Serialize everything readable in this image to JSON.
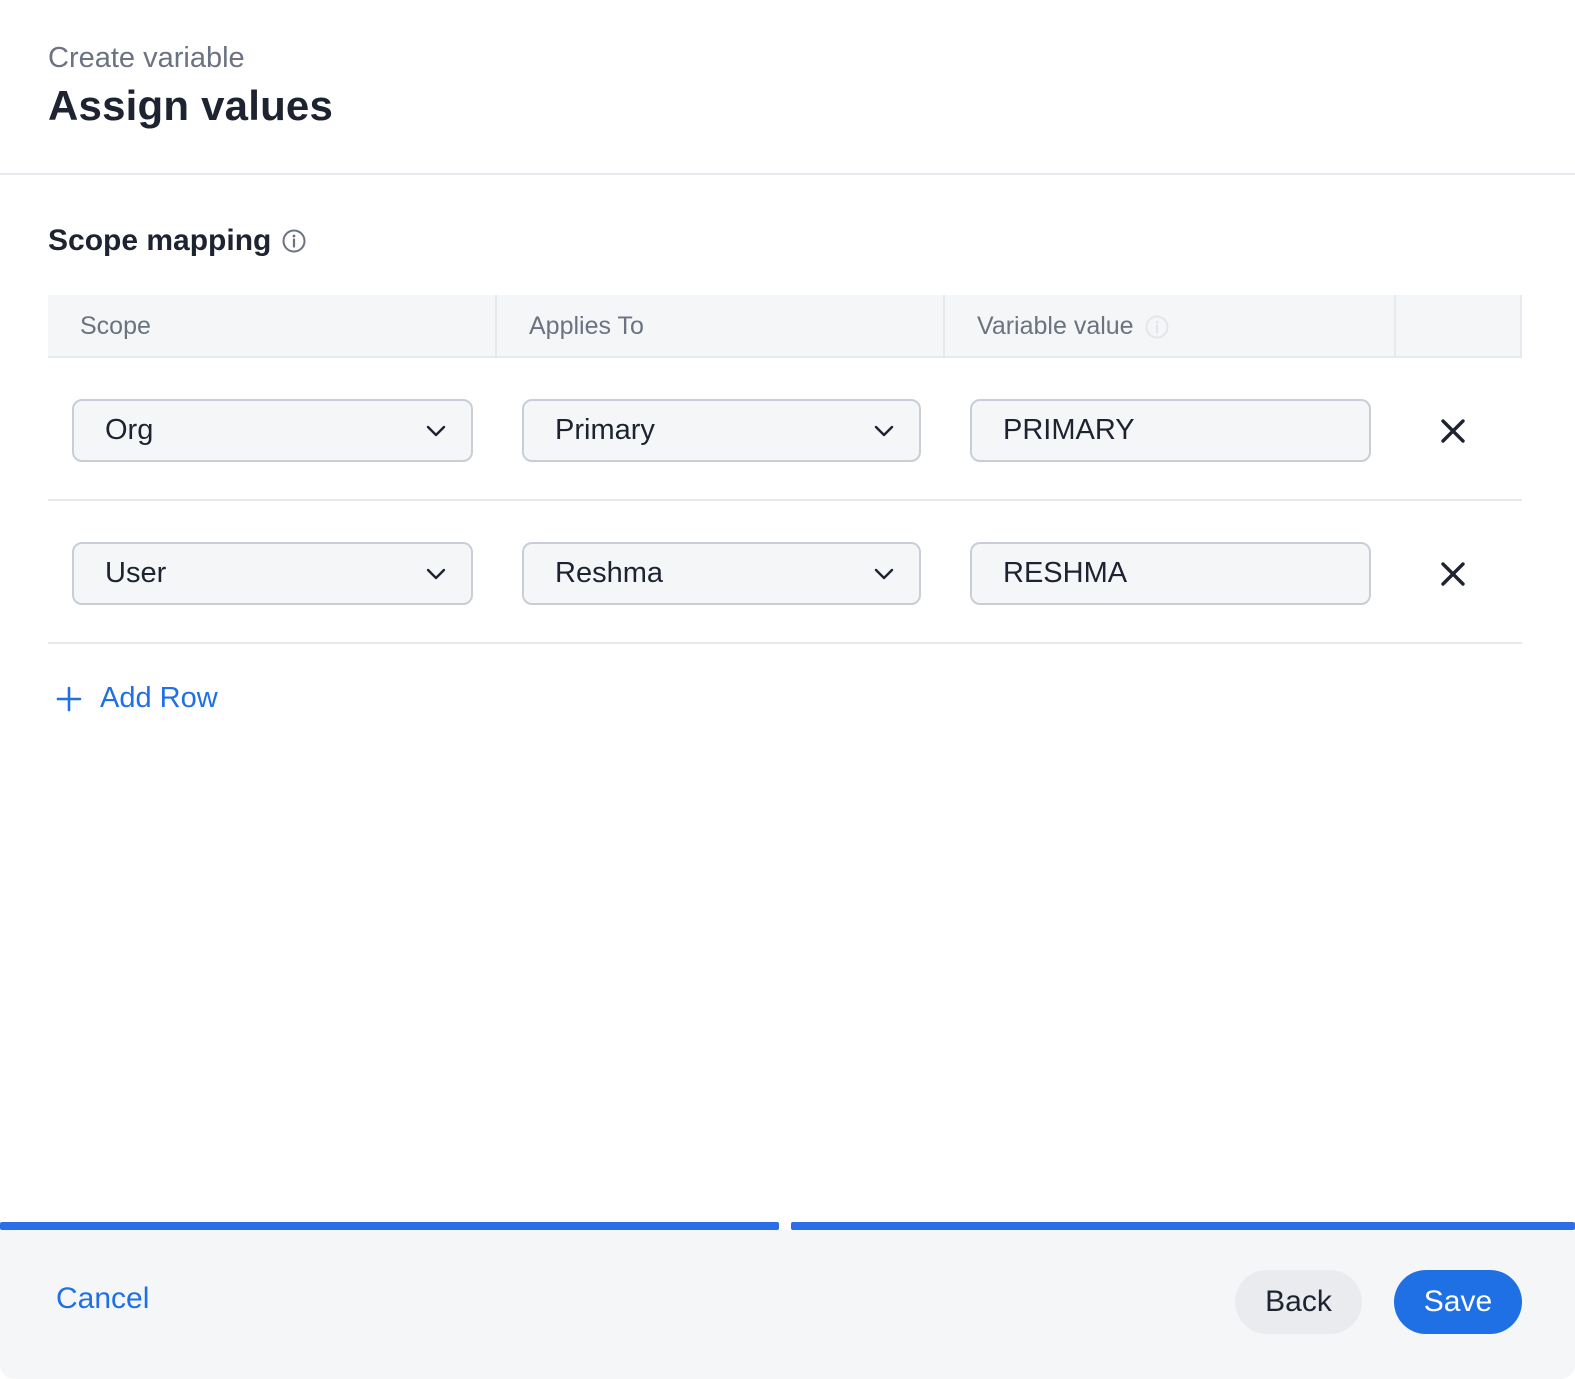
{
  "header": {
    "subtitle": "Create variable",
    "title": "Assign values"
  },
  "section": {
    "title": "Scope mapping",
    "info_icon": "info-icon"
  },
  "table": {
    "columns": [
      {
        "label": "Scope"
      },
      {
        "label": "Applies To"
      },
      {
        "label": "Variable value",
        "icon": "info-icon"
      },
      {
        "label": ""
      }
    ],
    "rows": [
      {
        "scope": "Org",
        "applies_to": "Primary",
        "value": "PRIMARY",
        "remove_icon": "close-icon"
      },
      {
        "scope": "User",
        "applies_to": "Reshma",
        "value": "RESHMA",
        "remove_icon": "close-icon"
      }
    ]
  },
  "add_row": {
    "label": "Add Row",
    "icon": "plus-icon"
  },
  "progress": {
    "steps": 2,
    "completed": 2,
    "color": "#2b6ee8"
  },
  "footer": {
    "cancel_label": "Cancel",
    "back_label": "Back",
    "save_label": "Save"
  },
  "colors": {
    "accent": "#1f6fe5",
    "text": "#1d2330",
    "muted": "#6b7280",
    "border": "#c9ced6",
    "surface": "#f5f6f8"
  }
}
